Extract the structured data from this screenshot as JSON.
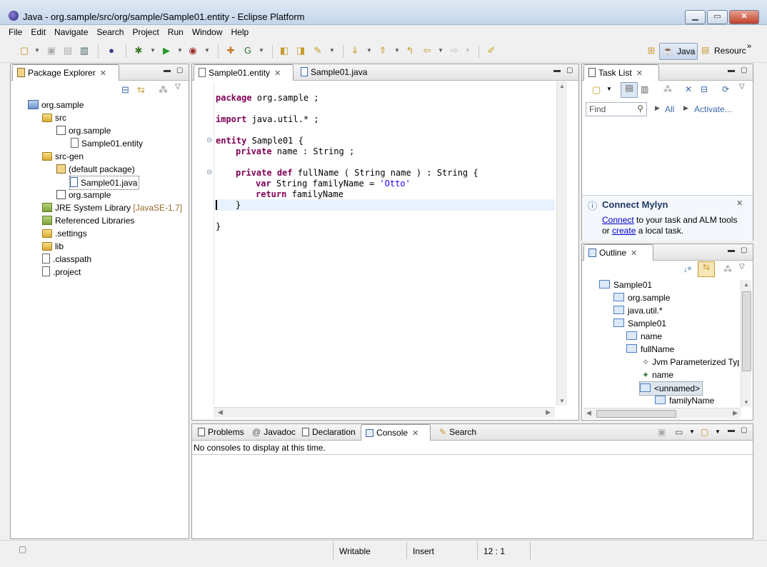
{
  "window": {
    "title": "Java - org.sample/src/org/sample/Sample01.entity - Eclipse Platform",
    "minimize": "▁",
    "maximize": "▭",
    "close": "✕"
  },
  "menu": [
    "File",
    "Edit",
    "Navigate",
    "Search",
    "Project",
    "Run",
    "Window",
    "Help"
  ],
  "perspectives": {
    "java": "Java",
    "resource": "Resourc",
    "more": "»"
  },
  "package_explorer": {
    "title": "Package Explorer",
    "tree": [
      {
        "label": "org.sample",
        "kind": "project"
      },
      {
        "label": "src",
        "kind": "folder"
      },
      {
        "label": "org.sample",
        "kind": "package"
      },
      {
        "label": "Sample01.entity",
        "kind": "file"
      },
      {
        "label": "src-gen",
        "kind": "folder"
      },
      {
        "label": "(default package)",
        "kind": "package"
      },
      {
        "label": "Sample01.java",
        "kind": "java"
      },
      {
        "label": "org.sample",
        "kind": "package"
      },
      {
        "label": "JRE System Library",
        "kind": "lib",
        "suffix": "[JavaSE-1.7]"
      },
      {
        "label": "Referenced Libraries",
        "kind": "lib"
      },
      {
        "label": ".settings",
        "kind": "folder"
      },
      {
        "label": "lib",
        "kind": "folder"
      },
      {
        "label": ".classpath",
        "kind": "file"
      },
      {
        "label": ".project",
        "kind": "file"
      }
    ]
  },
  "editor": {
    "tabs": [
      {
        "label": "Sample01.entity",
        "active": true
      },
      {
        "label": "Sample01.java",
        "active": false
      }
    ],
    "code": {
      "l1_kw": "package",
      "l1_rest": " org.sample ;",
      "l2_kw": "import",
      "l2_rest": " java.util.* ;",
      "l3_kw": "entity",
      "l3_rest": " Sample01 {",
      "l4_kw": "private",
      "l4_rest": " name : String ;",
      "l5_kw1": "private",
      "l5_kw2": "def",
      "l5_rest": " fullName ( String name ) : String {",
      "l6_kw": "var",
      "l6_mid": " String familyName = ",
      "l6_str": "'Otto'",
      "l7_kw": "return",
      "l7_rest": " familyName",
      "l8": "}",
      "l9": "}"
    }
  },
  "task_list": {
    "title": "Task List",
    "find_placeholder": "Find",
    "all": "All",
    "activate": "Activate..."
  },
  "mylyn": {
    "title": "Connect Mylyn",
    "connect": "Connect",
    "text1": " to your task and ALM tools",
    "or": "or ",
    "create": "create",
    "text2": " a local task."
  },
  "outline": {
    "title": "Outline",
    "items": [
      {
        "label": "Sample01"
      },
      {
        "label": "org.sample"
      },
      {
        "label": "java.util.*"
      },
      {
        "label": "Sample01"
      },
      {
        "label": "name"
      },
      {
        "label": "fullName"
      },
      {
        "label": "Jvm Parameterized Typ"
      },
      {
        "label": "name"
      },
      {
        "label": "<unnamed>"
      },
      {
        "label": "familyName"
      }
    ]
  },
  "bottom": {
    "tabs": [
      {
        "label": "Problems"
      },
      {
        "label": "Javadoc"
      },
      {
        "label": "Declaration"
      },
      {
        "label": "Console",
        "active": true
      },
      {
        "label": "Search"
      }
    ],
    "console_message": "No consoles to display at this time."
  },
  "status": {
    "writable": "Writable",
    "insert": "Insert",
    "position": "12 : 1"
  }
}
